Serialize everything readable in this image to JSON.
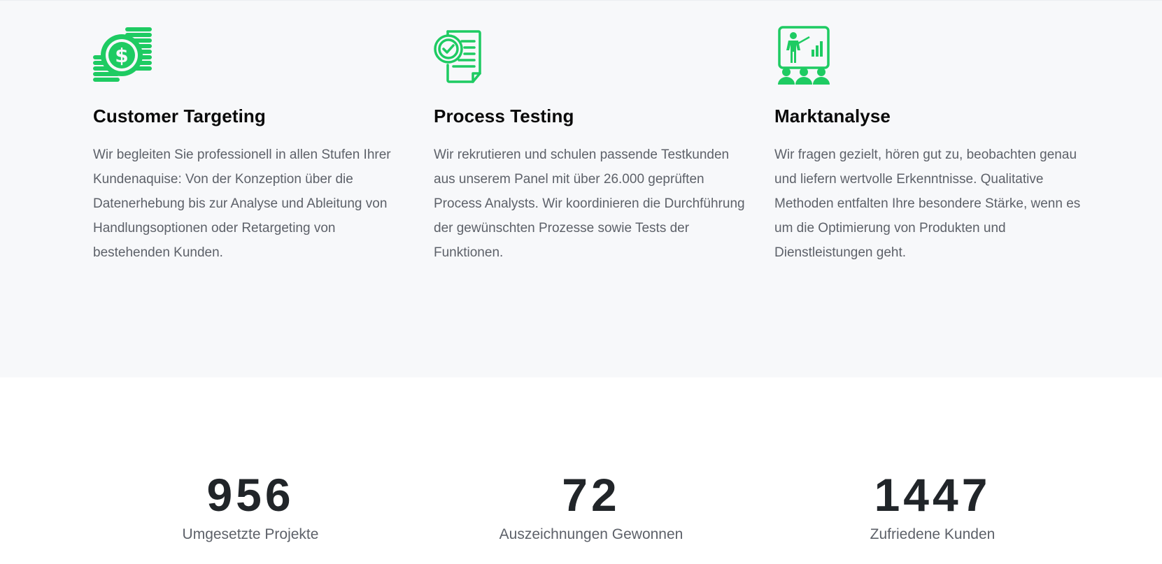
{
  "features": [
    {
      "icon": "money-coins-icon",
      "title": "Customer Targeting",
      "text": "Wir begleiten Sie professionell in allen Stufen Ihrer Kundenaquise: Von der Konzeption über die Datenerhebung bis zur Analyse und Ableitung von Handlungsoptionen oder Retargeting von bestehenden Kunden."
    },
    {
      "icon": "checklist-document-icon",
      "title": "Process Testing",
      "text": "Wir rekrutieren und schulen passende Testkunden aus unserem Panel mit über 26.000 geprüften Process Analysts. Wir koordinieren die Durchführung der gewünschten Prozesse sowie Tests der Funktionen."
    },
    {
      "icon": "presentation-audience-icon",
      "title": "Marktanalyse",
      "text": "Wir fragen gezielt, hören gut zu, beobachten genau und liefern wertvolle Erkenntnisse. Qualitative Methoden entfalten Ihre besondere Stärke, wenn es um die Optimierung von Produkten und Dienstleistungen geht."
    }
  ],
  "stats": [
    {
      "number": "956",
      "label": "Umgesetzte Projekte"
    },
    {
      "number": "72",
      "label": "Auszeichnungen Gewonnen"
    },
    {
      "number": "1447",
      "label": "Zufriedene Kunden"
    }
  ],
  "colors": {
    "accent": "#1ecb62",
    "section_bg": "#f7f8fa",
    "heading": "#0a0a0a",
    "body_text": "#5d6169",
    "stat_number": "#212529"
  }
}
